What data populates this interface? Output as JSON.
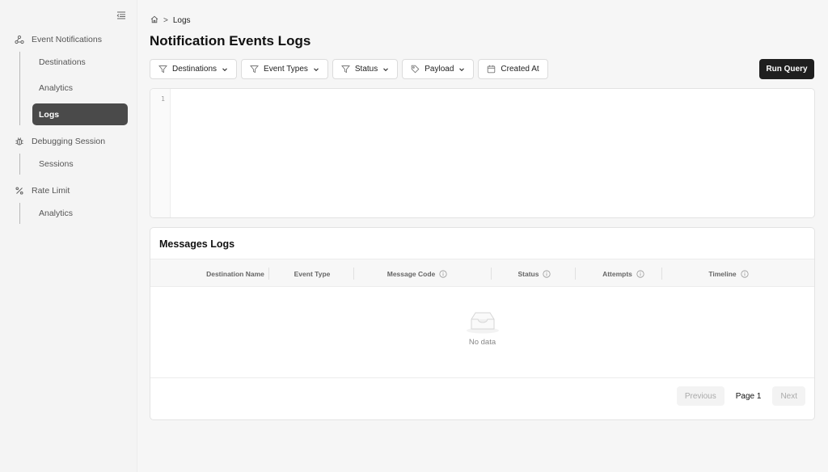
{
  "sidebar": {
    "groups": [
      {
        "label": "Event Notifications",
        "icon": "webhook-icon",
        "items": [
          "Destinations",
          "Analytics",
          "Logs"
        ]
      },
      {
        "label": "Debugging Session",
        "icon": "bug-icon",
        "items": [
          "Sessions"
        ]
      },
      {
        "label": "Rate Limit",
        "icon": "percent-icon",
        "items": [
          "Analytics"
        ]
      }
    ],
    "active_item": "Logs"
  },
  "breadcrumb": {
    "current": "Logs",
    "separator": ">"
  },
  "page_title": "Notification Events Logs",
  "filters": {
    "destinations": "Destinations",
    "event_types": "Event Types",
    "status": "Status",
    "payload": "Payload",
    "created_at": "Created At"
  },
  "run_query_label": "Run Query",
  "editor": {
    "line_number": "1"
  },
  "messages_logs": {
    "title": "Messages Logs",
    "columns": [
      "Destination Name",
      "Event Type",
      "Message Code",
      "Status",
      "Attempts",
      "Timeline"
    ],
    "empty_text": "No data"
  },
  "pagination": {
    "previous": "Previous",
    "page": "Page 1",
    "next": "Next"
  }
}
